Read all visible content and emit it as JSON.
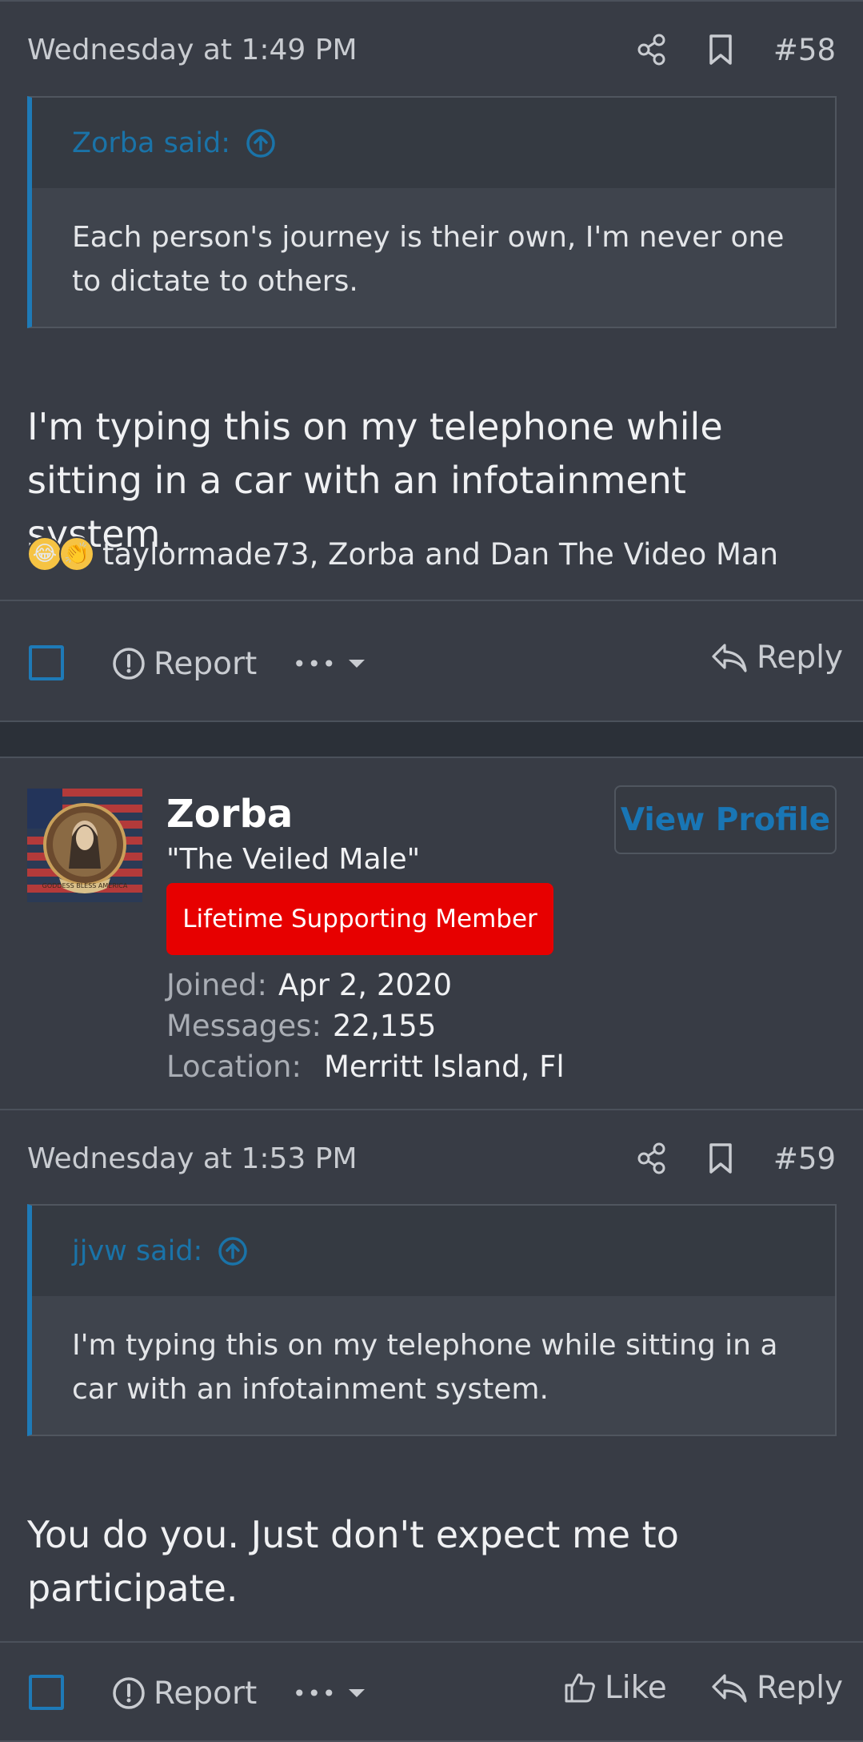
{
  "post58": {
    "date": "Wednesday at 1:49 PM",
    "number": "#58",
    "quote": {
      "author": "Zorba said:",
      "text": "Each person's journey is their own, I'm never one to dictate to others."
    },
    "body": "I'm typing this on my telephone while sitting in a car with an infotainment system.",
    "reactions": {
      "emoji": [
        "laughing-crying",
        "clapping"
      ],
      "text": "taylormade73, Zorba and Dan The Video Man"
    },
    "actions": {
      "report": "Report",
      "more": "•••",
      "reply": "Reply"
    }
  },
  "post59": {
    "user": {
      "name": "Zorba",
      "title": "\"The Veiled Male\"",
      "banner": "Lifetime Supporting Member",
      "view_profile": "View Profile",
      "stats": [
        {
          "label": "Joined:",
          "value": "Apr 2, 2020"
        },
        {
          "label": "Messages:",
          "value": "22,155"
        },
        {
          "label": "Location:",
          "value": "Merritt Island, Fl"
        }
      ],
      "avatar_text": "GODDESS BLESS AMERICA"
    },
    "date": "Wednesday at 1:53 PM",
    "number": "#59",
    "quote": {
      "author": "jjvw said:",
      "text": "I'm typing this on my telephone while sitting in a car with an infotainment system."
    },
    "body": "You do you. Just don't expect me to participate.",
    "actions": {
      "report": "Report",
      "more": "•••",
      "like": "Like",
      "reply": "Reply"
    }
  },
  "colors": {
    "accent": "#1e7ab7",
    "banner": "#e70000",
    "post_bg": "#383c45",
    "page_bg": "#2b3038"
  }
}
